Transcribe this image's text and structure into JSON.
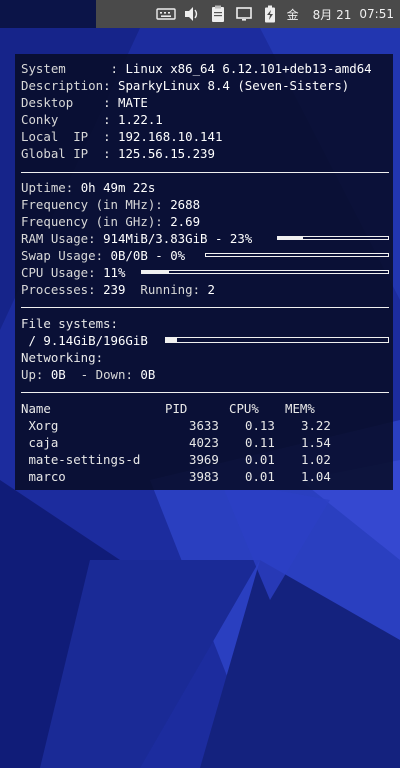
{
  "tray": {
    "ime_label": "金",
    "date": "8月 21",
    "time": "07:51"
  },
  "system": [
    {
      "label": "System     ",
      "value": "Linux x86_64 6.12.101+deb13-amd64"
    },
    {
      "label": "Description",
      "value": "SparkyLinux 8.4 (Seven-Sisters)"
    },
    {
      "label": "Desktop    ",
      "value": "MATE"
    },
    {
      "label": "Conky      ",
      "value": "1.22.1"
    },
    {
      "label": "Local  IP  ",
      "value": "192.168.10.141"
    },
    {
      "label": "Global IP  ",
      "value": "125.56.15.239"
    }
  ],
  "stats": {
    "uptime_label": "Uptime: ",
    "uptime": "0h 49m 22s",
    "freq_mhz_label": "Frequency (in MHz): ",
    "freq_mhz": "2688",
    "freq_ghz_label": "Frequency (in GHz): ",
    "freq_ghz": "2.69",
    "ram_label": "RAM Usage: ",
    "ram": "914MiB/3.83GiB - 23%",
    "ram_percent": 23,
    "swap_label": "Swap Usage: ",
    "swap": "0B/0B - 0%",
    "swap_percent": 0,
    "cpu_label": "CPU Usage: ",
    "cpu": "11%",
    "cpu_percent": 11,
    "processes_label": "Processes: ",
    "processes": "239",
    "running_label": "  Running: ",
    "running": "2"
  },
  "fs": {
    "heading": "File systems:",
    "root": " / 9.14GiB/196GiB",
    "root_percent": 5,
    "net_heading": "Networking:",
    "up_label": "Up: ",
    "up": "0B",
    "down_label": "  - Down: ",
    "down": "0B"
  },
  "procs": {
    "headers": [
      "Name",
      "PID",
      "CPU%",
      "MEM%"
    ],
    "rows": [
      {
        "name": " Xorg",
        "pid": "3633",
        "cpu": "0.13",
        "mem": "3.22"
      },
      {
        "name": " caja",
        "pid": "4023",
        "cpu": "0.11",
        "mem": "1.54"
      },
      {
        "name": " mate-settings-d",
        "pid": "3969",
        "cpu": "0.01",
        "mem": "1.02"
      },
      {
        "name": " marco",
        "pid": "3983",
        "cpu": "0.01",
        "mem": "1.04"
      }
    ]
  }
}
